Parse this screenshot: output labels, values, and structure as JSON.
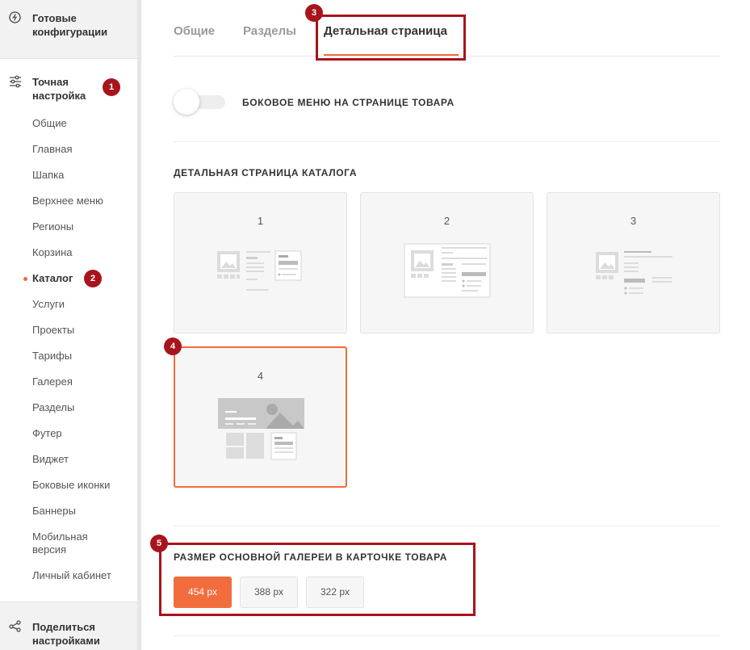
{
  "sidebar": {
    "top_label": "Готовые конфигурации",
    "section_label": "Точная настройка",
    "section_badge": "1",
    "items": [
      {
        "label": "Общие"
      },
      {
        "label": "Главная"
      },
      {
        "label": "Шапка"
      },
      {
        "label": "Верхнее меню"
      },
      {
        "label": "Регионы"
      },
      {
        "label": "Корзина"
      },
      {
        "label": "Каталог",
        "badge": "2"
      },
      {
        "label": "Услуги"
      },
      {
        "label": "Проекты"
      },
      {
        "label": "Тарифы"
      },
      {
        "label": "Галерея"
      },
      {
        "label": "Разделы"
      },
      {
        "label": "Футер"
      },
      {
        "label": "Виджет"
      },
      {
        "label": "Боковые иконки"
      },
      {
        "label": "Баннеры"
      },
      {
        "label": "Мобильная версия"
      },
      {
        "label": "Личный кабинет"
      }
    ],
    "bottom_label": "Поделиться настройками"
  },
  "tabs": [
    {
      "label": "Общие"
    },
    {
      "label": "Разделы"
    },
    {
      "label": "Детальная страница",
      "badge": "3"
    }
  ],
  "toggle": {
    "label": "БОКОВОЕ МЕНЮ НА СТРАНИЦЕ ТОВАРА",
    "state": "off"
  },
  "catalog": {
    "title": "ДЕТАЛЬНАЯ СТРАНИЦА КАТАЛОГА",
    "options": [
      {
        "number": "1"
      },
      {
        "number": "2"
      },
      {
        "number": "3"
      },
      {
        "number": "4",
        "badge": "4"
      }
    ],
    "selected": "4"
  },
  "gallery": {
    "title": "РАЗМЕР ОСНОВНОЙ ГАЛЕРЕИ В КАРТОЧКЕ ТОВАРА",
    "badge": "5",
    "sizes": [
      "454 px",
      "388 px",
      "322 px"
    ],
    "selected": "454 px"
  },
  "colors": {
    "accent": "#f26d3d",
    "annotation": "#a8141b"
  }
}
